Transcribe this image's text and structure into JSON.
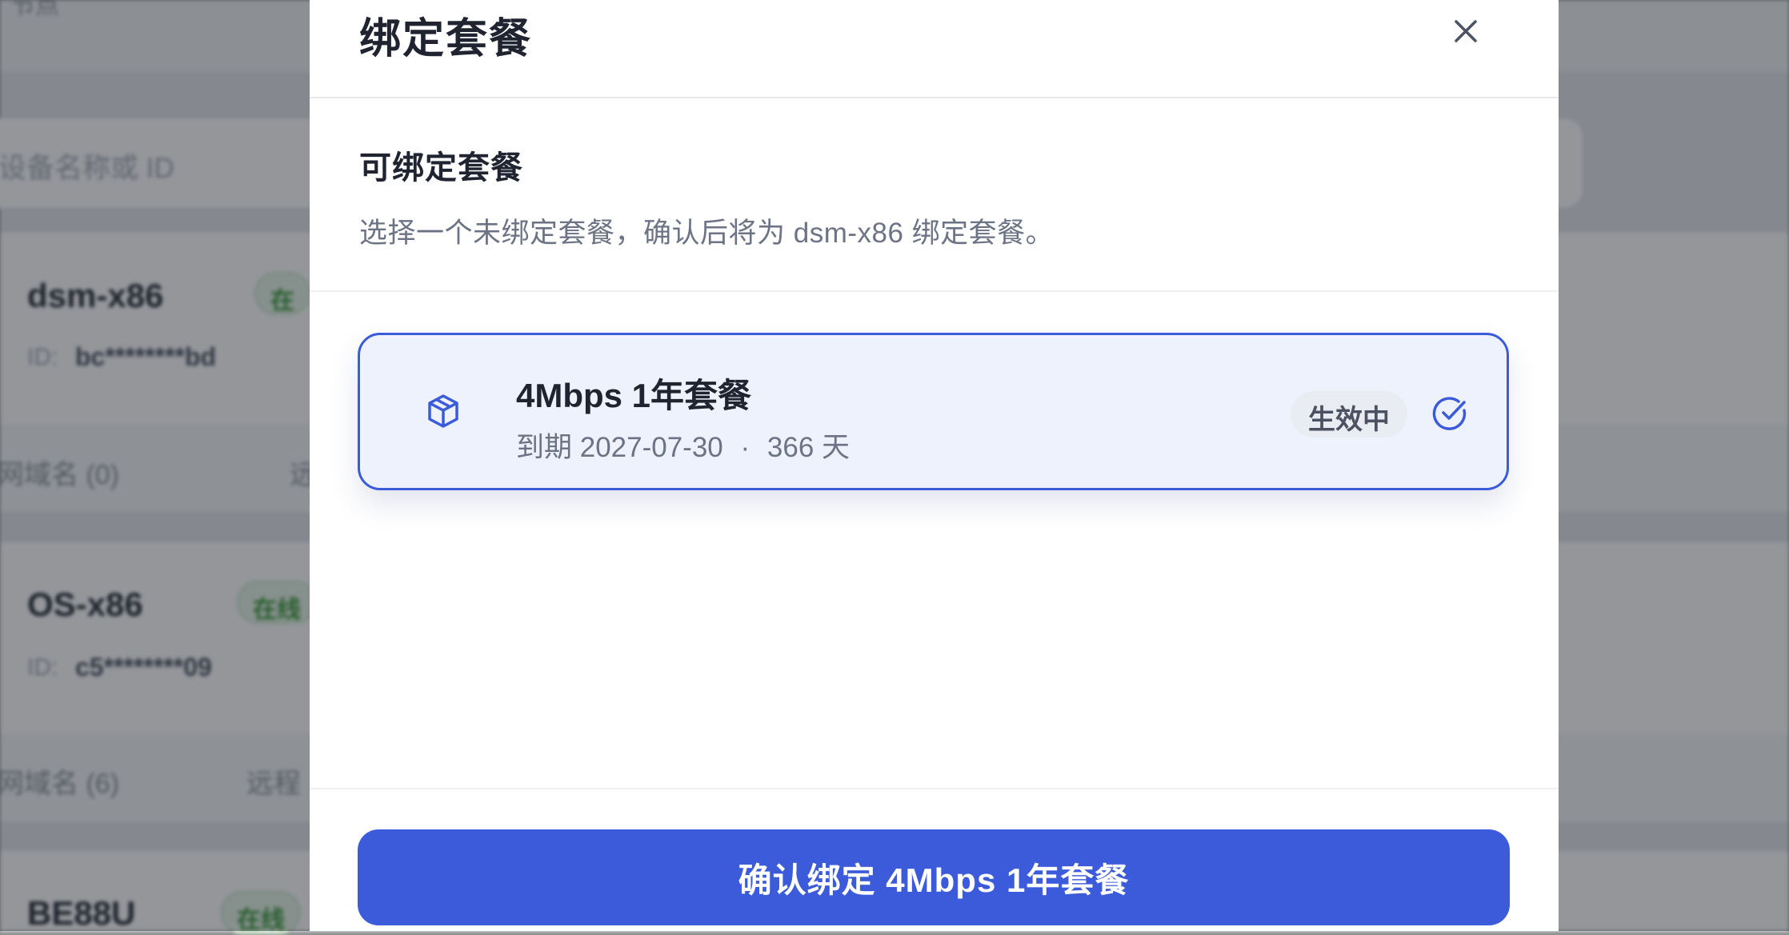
{
  "background": {
    "top_label": "节点",
    "search_placeholder": "设备名称或 ID",
    "devices": [
      {
        "name": "dsm-x86",
        "status": "在",
        "id_label": "ID:",
        "id_value": "bc********bd",
        "domains": "网域名 (0)",
        "action": "远"
      },
      {
        "name": "OS-x86",
        "status": "在线",
        "id_label": "ID:",
        "id_value": "c5********09",
        "domains": "网域名 (6)",
        "action": "远程"
      },
      {
        "name": "BE88U",
        "status": "在线"
      }
    ]
  },
  "modal": {
    "title": "绑定套餐",
    "close_icon": "close-icon",
    "section_title": "可绑定套餐",
    "section_desc": "选择一个未绑定套餐，确认后将为 dsm-x86 绑定套餐。",
    "plans": [
      {
        "icon": "package-icon",
        "name": "4Mbps 1年套餐",
        "expiry_label": "到期 2027-07-30",
        "separator": "·",
        "days": "366 天",
        "status": "生效中",
        "selected": true
      }
    ],
    "confirm_label": "确认绑定 4Mbps 1年套餐"
  },
  "colors": {
    "accent": "#3b5bdb",
    "selected_bg": "#eef2fc",
    "online_green": "#3a9a3a"
  }
}
